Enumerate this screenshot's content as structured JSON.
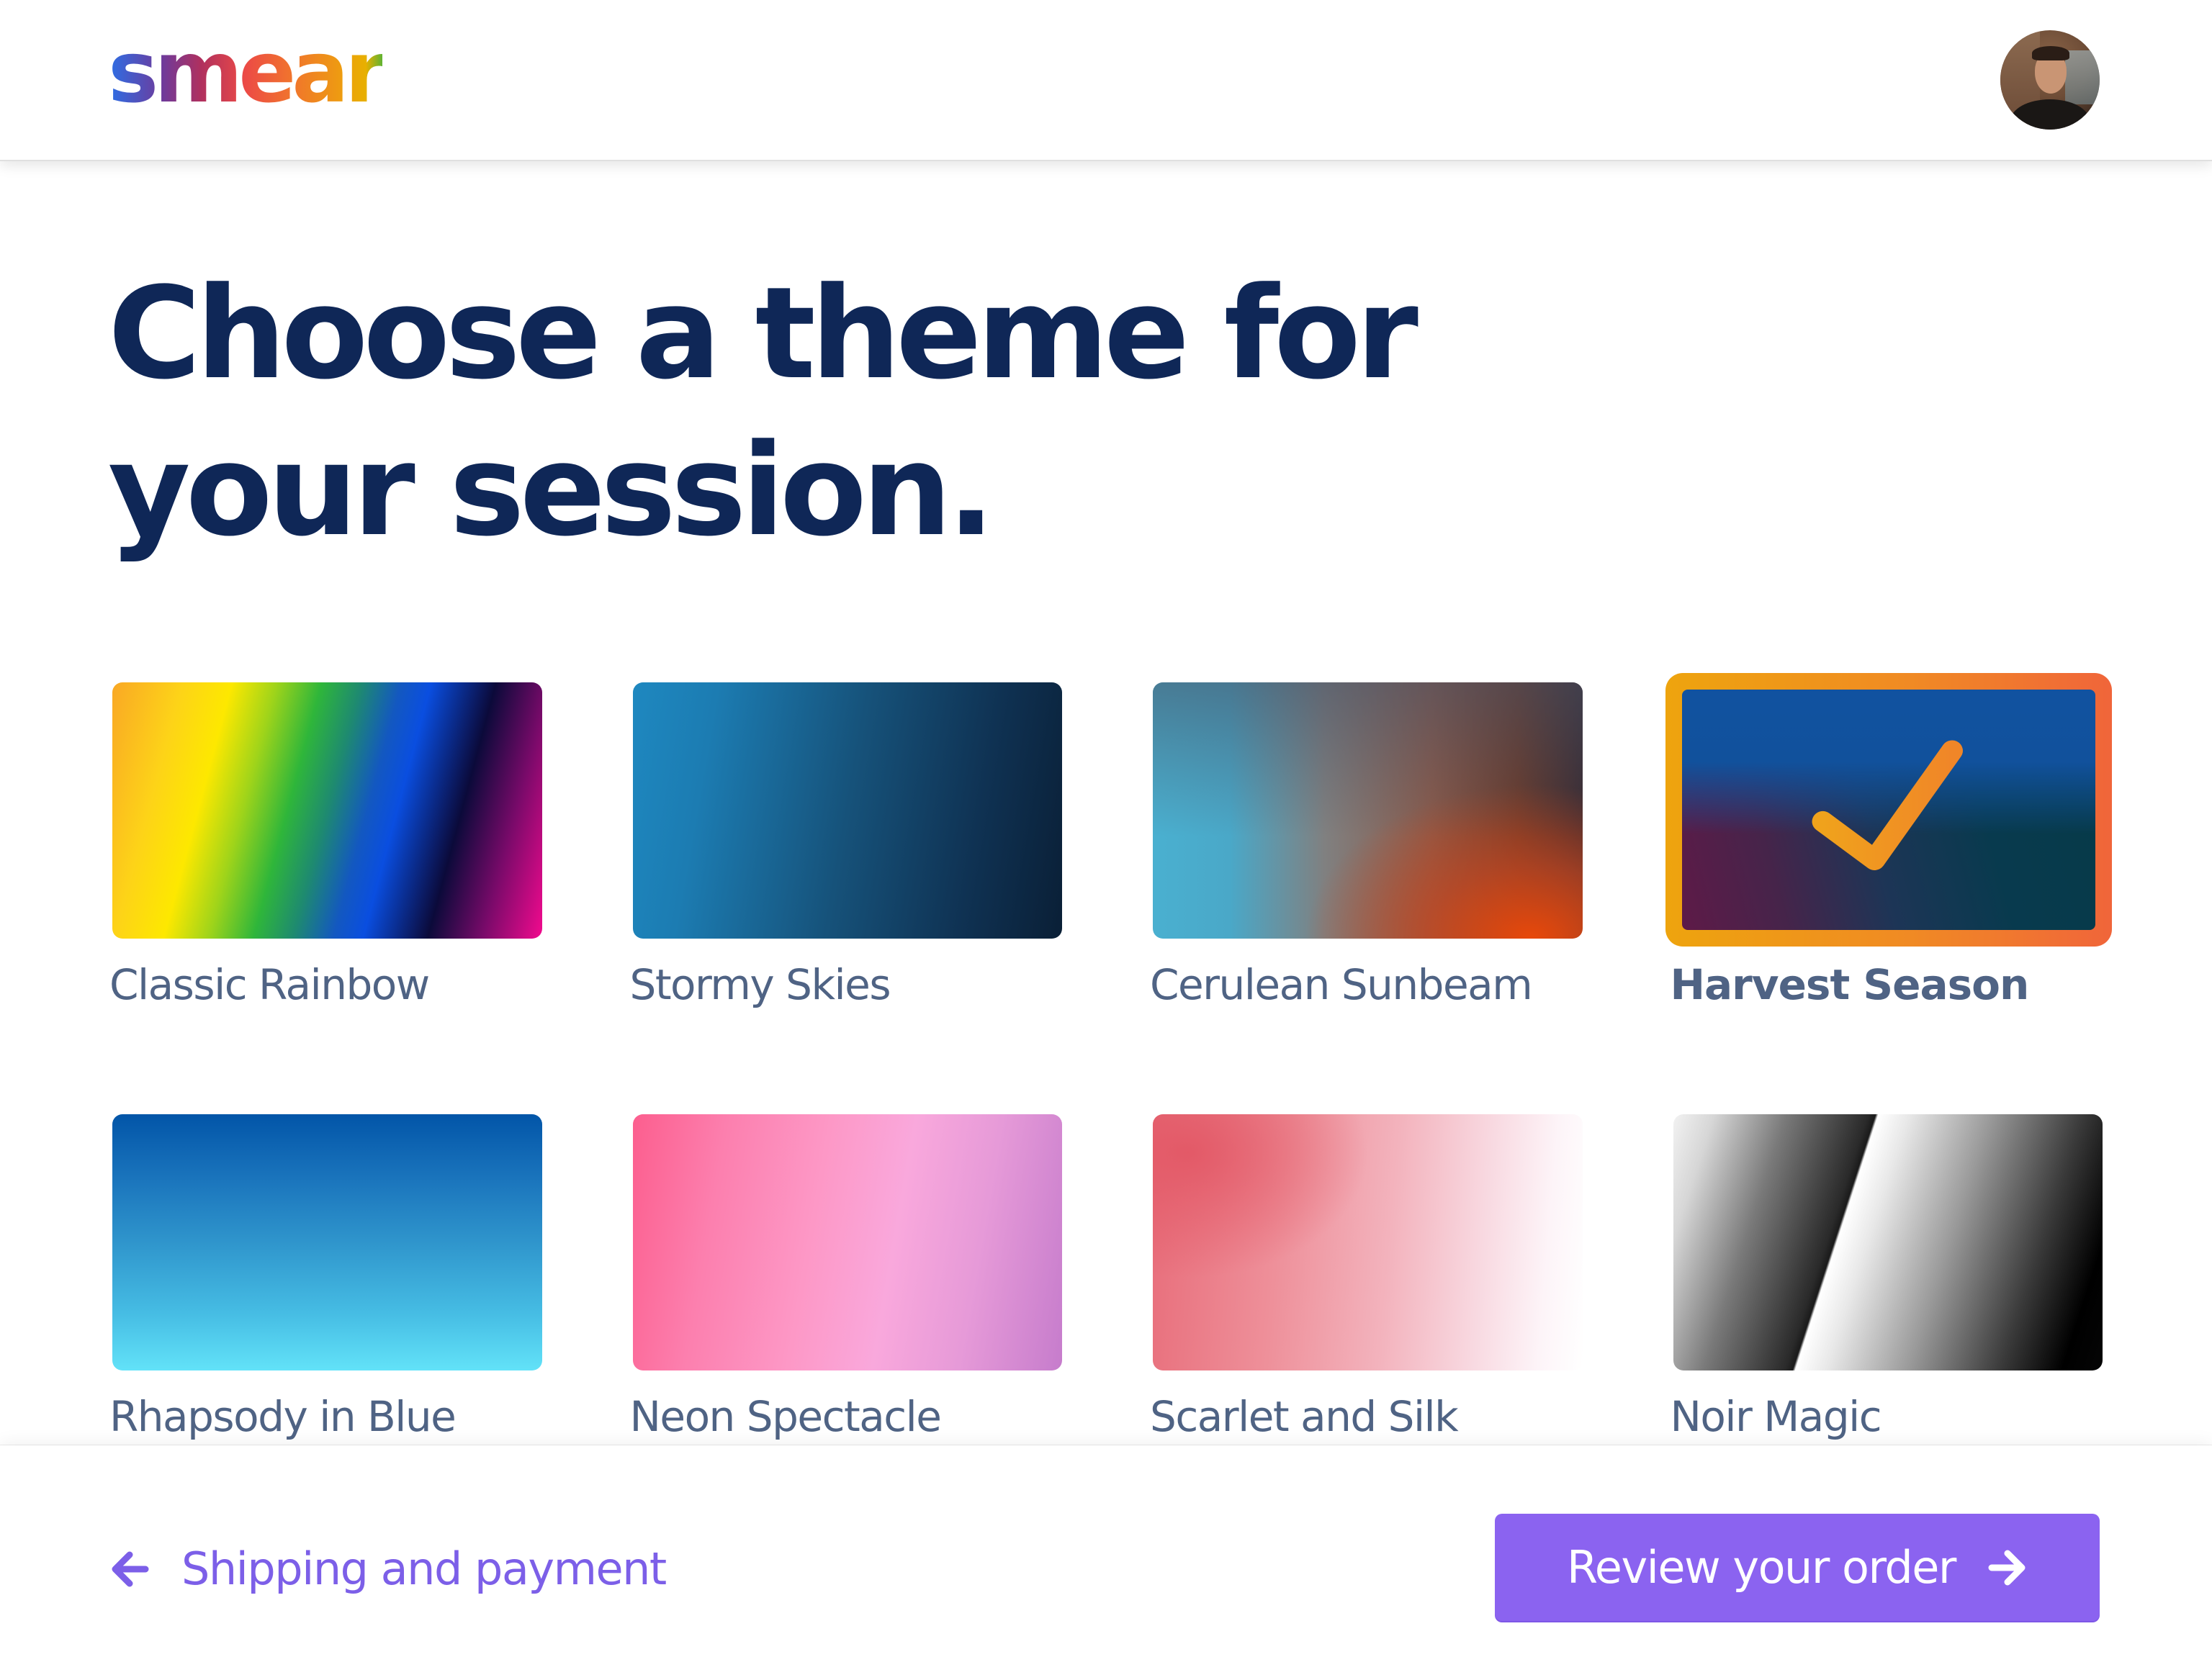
{
  "app": {
    "logo_text": "smear",
    "user_avatar_alt": "User profile photo"
  },
  "page": {
    "title": "Choose a theme for your session.",
    "title_line1": "Choose a theme for",
    "title_line2": "your session."
  },
  "themes": [
    {
      "name": "Classic Rainbow",
      "style": "g-rainbow",
      "selected": false
    },
    {
      "name": "Stormy Skies",
      "style": "g-stormy",
      "selected": false
    },
    {
      "name": "Cerulean Sunbeam",
      "style": "g-cerulean",
      "selected": false
    },
    {
      "name": "Harvest Season",
      "style": "g-harvest",
      "selected": true
    },
    {
      "name": "Rhapsody in Blue",
      "style": "g-rhapsody",
      "selected": false
    },
    {
      "name": "Neon Spectacle",
      "style": "g-neon",
      "selected": false
    },
    {
      "name": "Scarlet and Silk",
      "style": "g-scarlet",
      "selected": false
    },
    {
      "name": "Noir Magic",
      "style": "g-noir",
      "selected": false
    }
  ],
  "selected_theme": "Harvest Season",
  "footer": {
    "back_label": "Shipping and payment",
    "back_icon": "arrow-left-icon",
    "next_label": "Review your order",
    "next_icon": "arrow-right-icon"
  },
  "colors": {
    "heading": "#0f2757",
    "label": "#4f6384",
    "accent": "#8b63f0",
    "link": "#7c5fe8",
    "selected_border_start": "#eea40e",
    "selected_border_end": "#f0653a"
  }
}
